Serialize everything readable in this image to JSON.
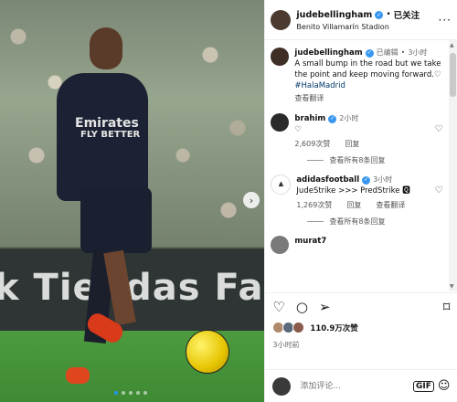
{
  "post": {
    "username": "judebellingham",
    "follow_label": "已关注",
    "location": "Benito Villamarín Stadion",
    "image": {
      "board_text": "k Tiendas Far",
      "shirt_sponsor_line1": "Emirates",
      "shirt_sponsor_line2": "FLY BETTER",
      "carousel_dots": 5,
      "active_dot": 1
    }
  },
  "caption": {
    "username": "judebellingham",
    "edited": "已编辑",
    "time": "3小时",
    "text": "A small bump in the road but we take the point and keep moving forward.",
    "heart": "♡",
    "hashtag": "#HalaMadrid",
    "translate": "查看翻译"
  },
  "comments": [
    {
      "username": "brahim",
      "time": "2小时",
      "text": "♡",
      "likes": "2,609次赞",
      "reply": "回复",
      "view_replies": "查看所有8条回复"
    },
    {
      "username": "adidasfootball",
      "time": "3小时",
      "text": "JudeStrike >>> PredStrike 🆀",
      "likes": "1,269次赞",
      "reply": "回复",
      "translate": "查看翻译",
      "view_replies": "查看所有8条回复"
    },
    {
      "username": "murat7",
      "time": "",
      "text": ""
    }
  ],
  "actions": {
    "likes": "110.9万次赞",
    "timestamp": "3小时前"
  },
  "composer": {
    "placeholder": "添加评论..."
  },
  "colors": {
    "verified": "#3897f0",
    "link": "#00376b",
    "active_dot": "#2196f3"
  }
}
